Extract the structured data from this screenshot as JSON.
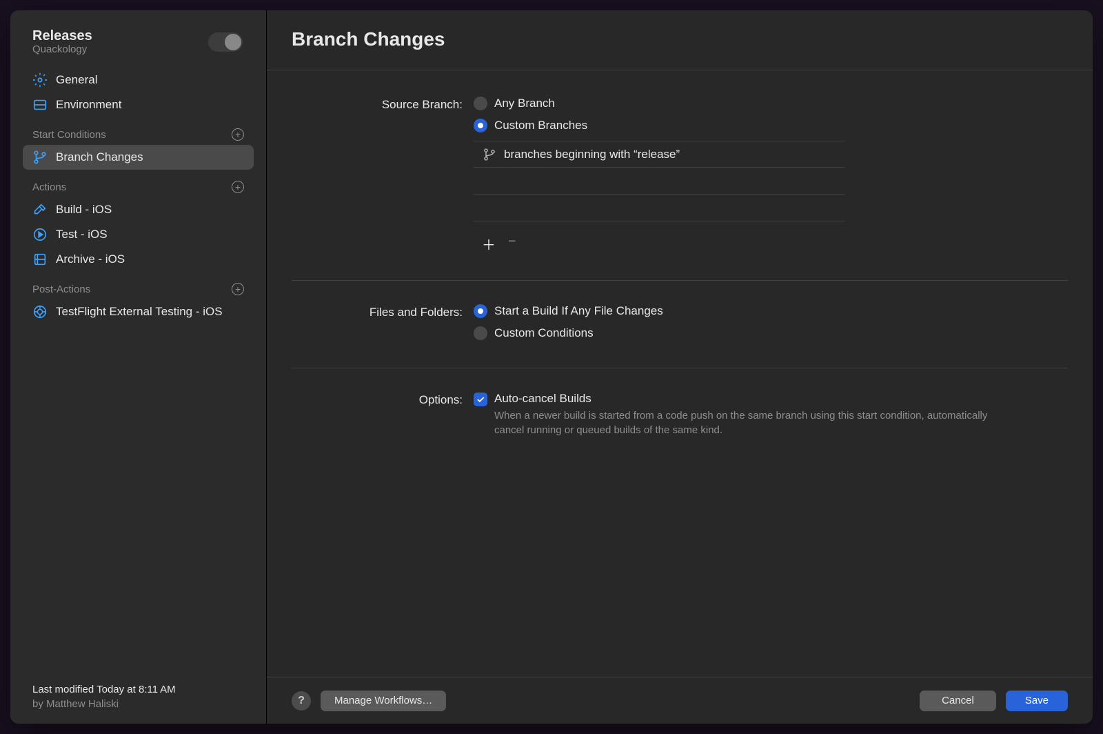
{
  "sidebar": {
    "header": {
      "title": "Releases",
      "subtitle": "Quackology"
    },
    "items": {
      "general": "General",
      "environment": "Environment"
    },
    "sections": {
      "start_conditions": {
        "title": "Start Conditions",
        "items": [
          "Branch Changes"
        ]
      },
      "actions": {
        "title": "Actions",
        "items": [
          "Build - iOS",
          "Test - iOS",
          "Archive - iOS"
        ]
      },
      "post_actions": {
        "title": "Post-Actions",
        "items": [
          "TestFlight External Testing - iOS"
        ]
      }
    },
    "footer": {
      "line1": "Last modified Today at 8:11 AM",
      "line2": "by Matthew Haliski"
    }
  },
  "main": {
    "title": "Branch Changes",
    "source_branch": {
      "label": "Source Branch:",
      "options": [
        "Any Branch",
        "Custom Branches"
      ],
      "selected": 1,
      "rules": [
        "branches beginning with “release”"
      ]
    },
    "files_folders": {
      "label": "Files and Folders:",
      "options": [
        "Start a Build If Any File Changes",
        "Custom Conditions"
      ],
      "selected": 0
    },
    "options": {
      "label": "Options:",
      "auto_cancel": {
        "label": "Auto-cancel Builds",
        "description": "When a newer build is started from a code push on the same branch using this start condition, automatically cancel running or queued builds of the same kind.",
        "checked": true
      }
    }
  },
  "footer": {
    "manage": "Manage Workflows…",
    "cancel": "Cancel",
    "save": "Save"
  },
  "colors": {
    "accent": "#2963d9"
  }
}
